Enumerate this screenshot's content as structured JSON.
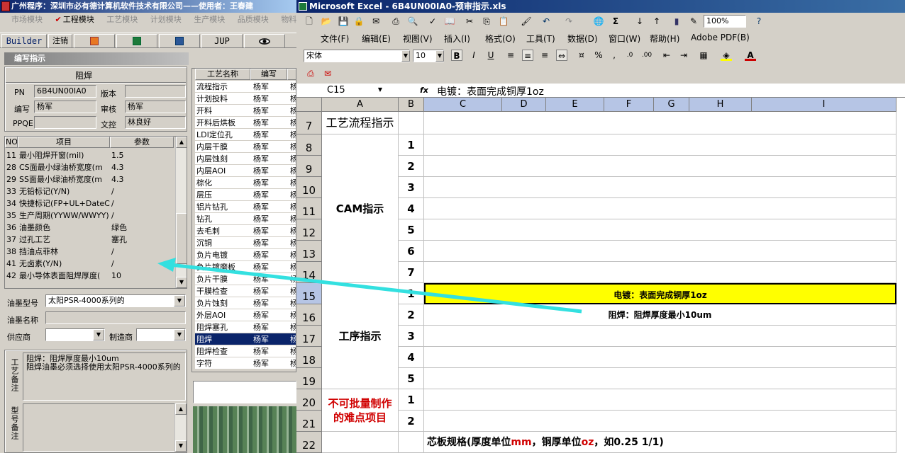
{
  "left_app": {
    "title": "广州程序：深圳市必有德计算机软件技术有限公司——使用者：王春建",
    "menu": [
      "市场模块",
      "工程模块",
      "工艺模块",
      "计划模块",
      "生产模块",
      "品质模块",
      "物料"
    ],
    "menu_check": "✔",
    "toolbar": {
      "builder": "Builder",
      "logout": "注销",
      "jup": "JUP"
    },
    "panel_title": "编写指示",
    "header_label": "阻焊",
    "pn_label": "PN",
    "pn_value": "6B4UN00IA0",
    "version_label": "版本",
    "version_value": "",
    "writer_label": "编写",
    "writer_value": "杨军",
    "reviewer_label": "审核",
    "reviewer_value": "杨军",
    "ppqe_label": "PPQE",
    "ppqe_value": "",
    "wenkong_label": "文控",
    "wenkong_value": "林良好",
    "param_grid": {
      "headers": [
        "NO",
        "项目",
        "参数"
      ],
      "rows": [
        [
          "11",
          "最小阻焊开窗(mil)",
          "1.5"
        ],
        [
          "28",
          "CS面最小绿油桥宽度(m",
          "4.3"
        ],
        [
          "29",
          "SS面最小绿油桥宽度(m",
          "4.3"
        ],
        [
          "33",
          "无铅标记(Y/N)",
          "/"
        ],
        [
          "34",
          "快捷标记(FP+UL+DateCo",
          "/"
        ],
        [
          "35",
          "生产周期(YYWW/WWYY)",
          "/"
        ],
        [
          "36",
          "油墨颜色",
          "绿色"
        ],
        [
          "37",
          "过孔工艺",
          "塞孔"
        ],
        [
          "38",
          "挡油点菲林",
          "/"
        ],
        [
          "41",
          "无卤素(Y/N)",
          "/"
        ],
        [
          "42",
          "最小导体表面阻焊厚度(",
          "10"
        ]
      ]
    },
    "ink_type_label": "油墨型号",
    "ink_type_value": "太阳PSR-4000系列的",
    "ink_name_label": "油墨名称",
    "ink_name_value": "",
    "supplier_label": "供应商",
    "supplier_value": "",
    "maker_label": "制造商",
    "maker_value": "",
    "process_note_label": "工艺备注",
    "process_note": "阻焊：阻焊厚度最小10um\n阻焊油墨必须选择使用太阳PSR-4000系列的",
    "model_note_label": "型号备注",
    "process_grid": {
      "headers": [
        "工艺名称",
        "编写",
        ""
      ],
      "rows": [
        [
          "流程指示",
          "杨军",
          "杨"
        ],
        [
          "计划投料",
          "杨军",
          "杨"
        ],
        [
          "开料",
          "杨军",
          "杨"
        ],
        [
          "开料后烘板",
          "杨军",
          "杨"
        ],
        [
          "LDI定位孔",
          "杨军",
          "杨"
        ],
        [
          "内层干膜",
          "杨军",
          "杨"
        ],
        [
          "内层蚀刻",
          "杨军",
          "杨"
        ],
        [
          "内层AOI",
          "杨军",
          "杨"
        ],
        [
          "棕化",
          "杨军",
          "杨"
        ],
        [
          "层压",
          "杨军",
          "杨"
        ],
        [
          "铝片钻孔",
          "杨军",
          "杨"
        ],
        [
          "钻孔",
          "杨军",
          "杨"
        ],
        [
          "去毛刺",
          "杨军",
          "杨"
        ],
        [
          "沉铜",
          "杨军",
          "杨"
        ],
        [
          "负片电镀",
          "杨军",
          "杨"
        ],
        [
          "负片镀磨板",
          "杨军",
          "杨"
        ],
        [
          "负片干膜",
          "杨军",
          "杨"
        ],
        [
          "干膜检查",
          "杨军",
          "杨"
        ],
        [
          "负片蚀刻",
          "杨军",
          "杨"
        ],
        [
          "外层AOI",
          "杨军",
          "杨"
        ],
        [
          "阻焊塞孔",
          "杨军",
          "杨"
        ],
        [
          "阻焊",
          "杨军",
          "杨"
        ],
        [
          "阻焊检查",
          "杨军",
          "杨"
        ],
        [
          "字符",
          "杨军",
          "杨"
        ]
      ],
      "selected_index": 21
    }
  },
  "excel": {
    "title": "Microsoft Excel - 6B4UN00IA0-预审指示.xls",
    "zoom": "100%",
    "menu": [
      "文件(F)",
      "编辑(E)",
      "视图(V)",
      "插入(I)",
      "格式(O)",
      "工具(T)",
      "数据(D)",
      "窗口(W)",
      "帮助(H)",
      "Adobe PDF(B)"
    ],
    "font_name": "宋体",
    "font_size": "10",
    "name_box": "C15",
    "fx": "fx",
    "formula": "电镀：表面完成铜厚1oz",
    "columns": [
      "A",
      "B",
      "C",
      "D",
      "E",
      "F",
      "G",
      "H",
      "I"
    ],
    "rows": [
      "7",
      "8",
      "9",
      "10",
      "11",
      "12",
      "13",
      "14",
      "15",
      "16",
      "17",
      "18",
      "19",
      "20",
      "21",
      "22"
    ],
    "a7": "工艺流程指示",
    "cam_label": "CAM指示",
    "process_label": "工序指示",
    "difficult_label_1": "不可批量制作",
    "difficult_label_2": "的难点项目",
    "b_cam": [
      "1",
      "2",
      "3",
      "4",
      "5",
      "6",
      "7"
    ],
    "b_process": [
      "1",
      "2",
      "3",
      "4",
      "5"
    ],
    "b_difficult": [
      "1",
      "2"
    ],
    "c15": "电镀：表面完成铜厚1oz",
    "c16": "阻焊：阻焊厚度最小10um",
    "row22_text_a": "芯板规格(厚度单位",
    "row22_mm": "mm",
    "row22_text_b": "，铜厚单位",
    "row22_oz": "oz",
    "row22_text_c": "，如0.25 1/1)",
    "highlight_color": "#ffff00",
    "arrow_color": "#33e0e0"
  }
}
